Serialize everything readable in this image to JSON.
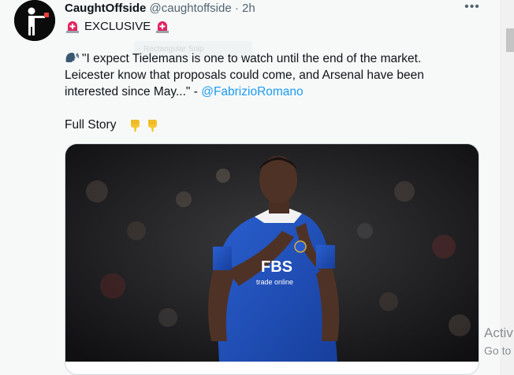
{
  "tweet": {
    "author_name": "CaughtOffside",
    "handle": "@caughtoffside",
    "separator": "·",
    "time": "2h",
    "more_label": "•••",
    "exclusive_label": "EXCLUSIVE",
    "quote_text": "\"I expect Tielemans is one to watch until the end of the market. Leicester know that proposals could come, and Arsenal have been interested since May...\" - ",
    "mention": "@FabrizioRomano",
    "full_story_label": "Full Story",
    "ghost_text": "Rectangular Snip"
  },
  "card": {
    "shirt_sponsor": "FBS",
    "shirt_sponsor_sub": "trade online"
  },
  "watermark": {
    "line1": "Activ",
    "line2": "Go to"
  },
  "colors": {
    "link": "#1d9bf0",
    "secondary_text": "#536471",
    "siren": "#e0245e",
    "jersey": "#1f4fb4"
  },
  "icons": {
    "siren": "police-car-light-icon",
    "speaker": "speaking-head-icon",
    "hand": "backhand-index-pointing-down-icon"
  }
}
